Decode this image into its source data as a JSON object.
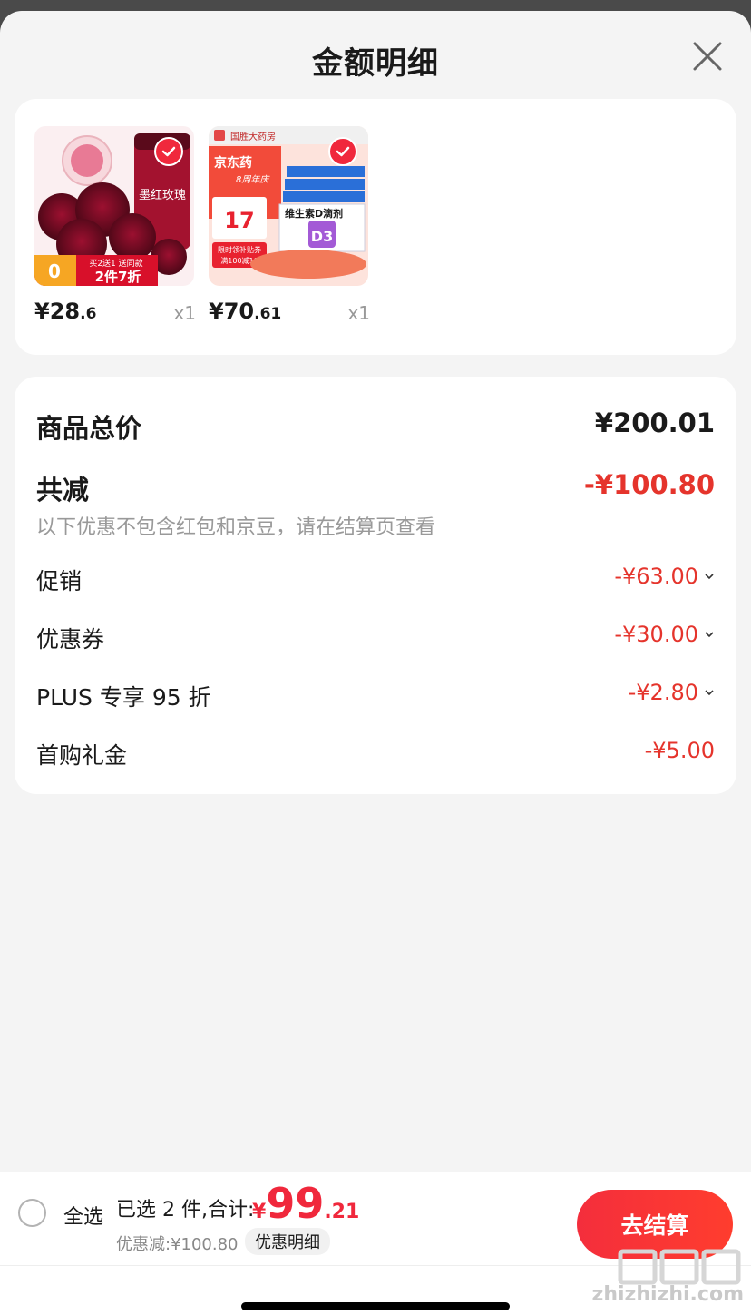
{
  "header": {
    "title": "金额明细"
  },
  "products": [
    {
      "price_int": "¥28",
      "price_dec": ".6",
      "qty": "x1",
      "thumb_text": "墨红玫瑰",
      "promo_text": "2件7折",
      "promo_small": "买2送1 送同款"
    },
    {
      "price_int": "¥70",
      "price_dec": ".61",
      "qty": "x1",
      "brand": "国胜大药房",
      "banner1": "京东药",
      "banner2": "8周年庆",
      "badge_num": "17",
      "coupon1": "限时领补贴券",
      "coupon2": "满100减10",
      "box_label": "维生素D滴剂",
      "d3": "D3"
    }
  ],
  "summary": {
    "total_label": "商品总价",
    "total_value": "¥200.01",
    "reduce_label": "共减",
    "reduce_value": "-¥100.80",
    "note": "以下优惠不包含红包和京豆，请在结算页查看",
    "items": [
      {
        "label": "促销",
        "value": "-¥63.00",
        "expandable": true
      },
      {
        "label": "优惠券",
        "value": "-¥30.00",
        "expandable": true
      },
      {
        "label": "PLUS 专享 95 折",
        "value": "-¥2.80",
        "expandable": true
      },
      {
        "label": "首购礼金",
        "value": "-¥5.00",
        "expandable": false
      }
    ]
  },
  "bottom": {
    "select_all": "全选",
    "selected_text": "已选 2 件,合计:",
    "total_yen": "¥",
    "total_int": "99",
    "total_dec": ".21",
    "discount_text": "优惠减:¥100.80",
    "detail_link": "优惠明细",
    "checkout": "去结算"
  },
  "watermark": "zhizhizhi.com",
  "colors": {
    "accent_red": "#e5342c",
    "button_red": "#f42e3c",
    "check_red": "#f0283c"
  }
}
